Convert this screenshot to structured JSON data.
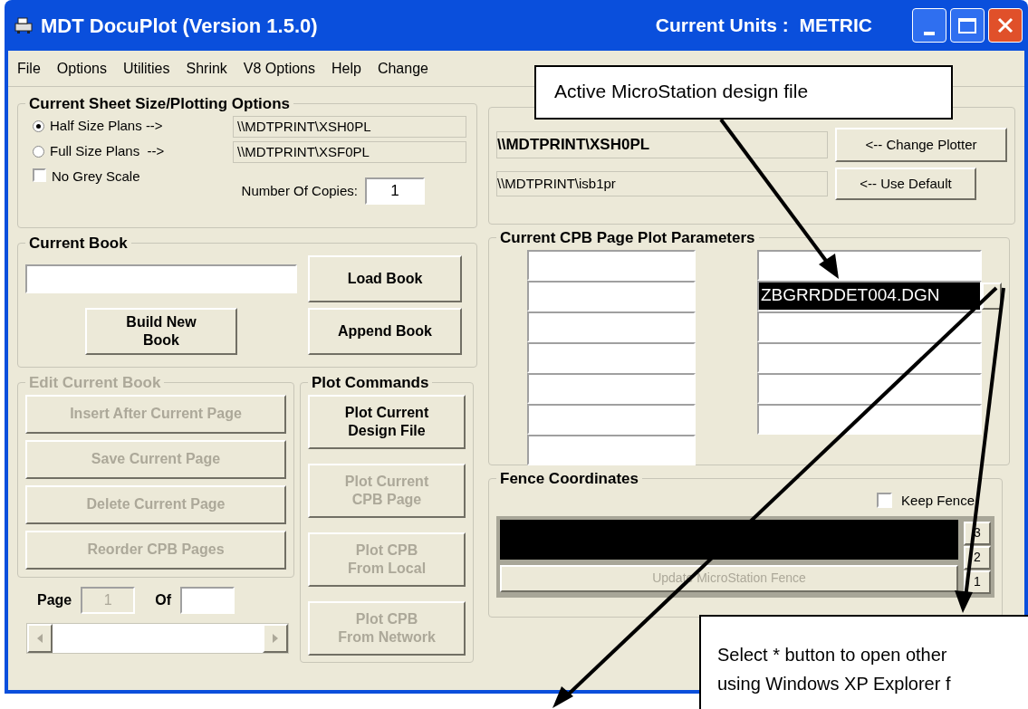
{
  "window": {
    "title": "MDT DocuPlot (Version 1.5.0)",
    "units": "Current Units :  METRIC"
  },
  "menu": [
    "File",
    "Options",
    "Utilities",
    "Shrink",
    "V8 Options",
    "Help",
    "Change"
  ],
  "sheet_options": {
    "title": "Current Sheet Size/Plotting Options",
    "options": [
      {
        "label": "Half Size Plans -->",
        "path": "\\\\MDTPRINT\\XSH0PL",
        "selected": true
      },
      {
        "label": "Full Size Plans  -->",
        "path": "\\\\MDTPRINT\\XSF0PL",
        "selected": false
      }
    ],
    "grey_scale": {
      "label": "No Grey Scale",
      "checked": false
    },
    "copies": {
      "label": "Number Of Copies:",
      "value": "1"
    }
  },
  "current_book": {
    "title": "Current Book",
    "buttons": [
      {
        "lines": [
          "Load Book"
        ]
      },
      {
        "lines": [
          "Build New",
          "Book"
        ]
      },
      {
        "lines": [
          "Append Book"
        ]
      }
    ]
  },
  "edit_book": {
    "title": "Edit Current Book",
    "disabled": true,
    "buttons": [
      {
        "label": "Insert After Current Page",
        "disabled": true
      },
      {
        "label": "Save Current Page",
        "disabled": true
      },
      {
        "label": "Delete Current Page",
        "disabled": true
      },
      {
        "label": "Reorder CPB Pages",
        "disabled": true
      }
    ]
  },
  "page_nav": {
    "page_label": "Page",
    "page_value": "1",
    "of_label": "Of"
  },
  "plot_commands": {
    "title": "Plot Commands",
    "buttons": [
      {
        "lines": [
          "Plot Current",
          "Design File"
        ],
        "disabled": false
      },
      {
        "lines": [
          "Plot Current",
          "CPB Page"
        ],
        "disabled": true
      },
      {
        "lines": [
          "Plot CPB",
          "From Local"
        ],
        "disabled": true
      },
      {
        "lines": [
          "Plot CPB",
          "From Network"
        ],
        "disabled": true
      }
    ]
  },
  "current_plotter": {
    "plotter": "\\\\MDTPRINT\\XSH0PL",
    "default": "\\\\MDTPRINT\\isb1pr",
    "buttons": [
      "<-- Change Plotter",
      "<-- Use Default"
    ]
  },
  "cpb_params": {
    "title": "Current CPB Page Plot Parameters",
    "column_1": [
      {
        "selected": false
      },
      {
        "selected": false
      },
      {
        "selected": false
      },
      {
        "selected": false
      },
      {
        "selected": false
      },
      {
        "selected": false
      },
      {
        "selected": false
      }
    ],
    "column_2": [
      {
        "selected": false
      },
      {
        "value": "ZBGRRDDET004.DGN",
        "selected": true
      },
      {
        "selected": false
      },
      {
        "selected": false
      },
      {
        "selected": false
      },
      {
        "selected": false
      }
    ]
  },
  "fence": {
    "title": "Fence Coordinates",
    "keep_fence": {
      "label": "Keep Fence",
      "checked": false
    },
    "buttons": [
      "3",
      "2",
      "1"
    ],
    "update_button": {
      "label": "Update MicroStation Fence",
      "disabled": true
    }
  },
  "callouts": [
    {
      "lines": [
        "Active MicroStation design file"
      ]
    },
    {
      "lines": [
        "Select * button to open other",
        "using Windows XP Explorer f"
      ]
    }
  ]
}
